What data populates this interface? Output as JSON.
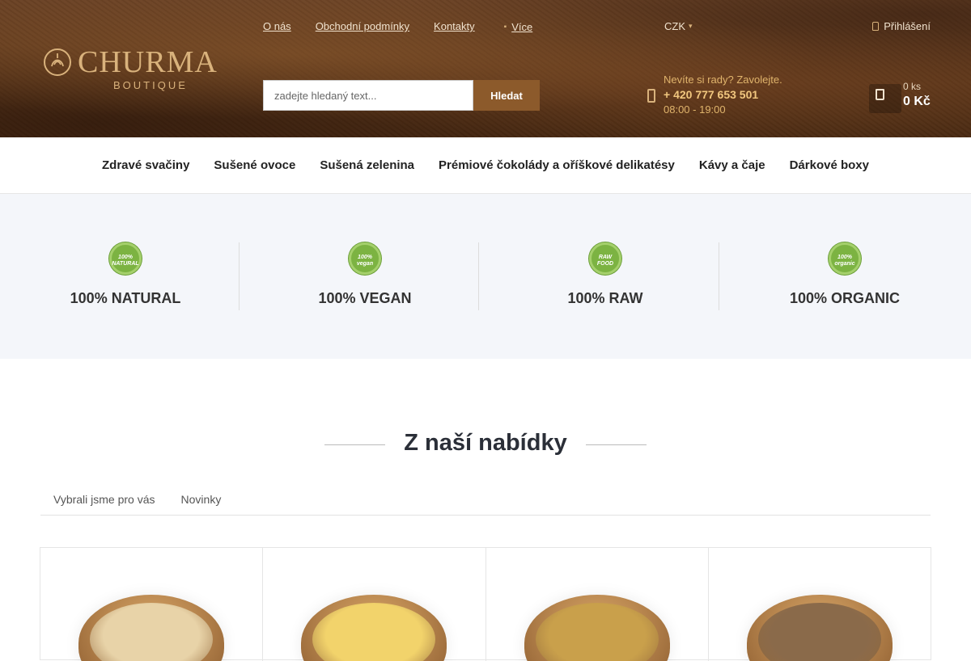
{
  "brand": {
    "name": "CHURMA",
    "sub": "BOUTIQUE",
    "accent": "#d9b27c"
  },
  "topnav": {
    "items": [
      "O nás",
      "Obchodní podmínky",
      "Kontakty"
    ],
    "more_label": "Více",
    "currency": "CZK",
    "login": "Přihlášení"
  },
  "search": {
    "placeholder": "zadejte hledaný text...",
    "button": "Hledat"
  },
  "contact": {
    "line1": "Nevíte si rady? Zavolejte.",
    "phone": "+ 420 777 653 501",
    "hours": "08:00 - 19:00"
  },
  "cart": {
    "count": "0 ks",
    "price": "0 Kč"
  },
  "categories": [
    "Zdravé svačiny",
    "Sušené ovoce",
    "Sušená zelenina",
    "Prémiové čokolády a oříškové delikatésy",
    "Kávy a čaje",
    "Dárkové boxy"
  ],
  "benefits": [
    {
      "badge": "100% NATURAL",
      "title": "100% NATURAL"
    },
    {
      "badge": "100% vegan",
      "title": "100% VEGAN"
    },
    {
      "badge": "RAW FOOD",
      "title": "100% RAW"
    },
    {
      "badge": "100% organic",
      "title": "100% ORGANIC"
    }
  ],
  "offer": {
    "title": "Z naší nabídky",
    "tabs": [
      "Vybrali jsme pro vás",
      "Novinky"
    ]
  },
  "products": [
    {
      "fill_color": "#e8d3a8"
    },
    {
      "fill_color": "#f2d36b"
    },
    {
      "fill_color": "#c9a04b"
    },
    {
      "fill_color": "#8a6a4a"
    }
  ]
}
